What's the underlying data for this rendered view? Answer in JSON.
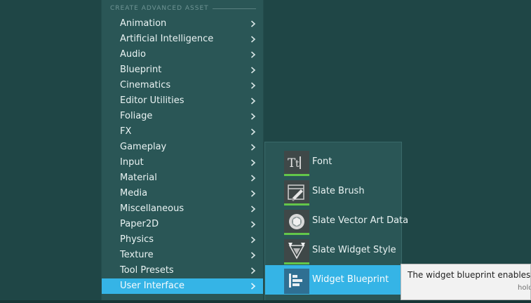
{
  "colors": {
    "background": "#1f4646",
    "menu_bg": "#2a5656",
    "selected_bg": "#35b4e6",
    "thumbnail_bar": "#63c64a",
    "tooltip_bg": "#f2f2f2"
  },
  "menu": {
    "section_header": "CREATE ADVANCED ASSET",
    "items": [
      {
        "label": "Animation",
        "icon": "chevron-right-icon"
      },
      {
        "label": "Artificial Intelligence",
        "icon": "chevron-right-icon"
      },
      {
        "label": "Audio",
        "icon": "chevron-right-icon"
      },
      {
        "label": "Blueprint",
        "icon": "chevron-right-icon"
      },
      {
        "label": "Cinematics",
        "icon": "chevron-right-icon"
      },
      {
        "label": "Editor Utilities",
        "icon": "chevron-right-icon"
      },
      {
        "label": "Foliage",
        "icon": "chevron-right-icon"
      },
      {
        "label": "FX",
        "icon": "chevron-right-icon"
      },
      {
        "label": "Gameplay",
        "icon": "chevron-right-icon"
      },
      {
        "label": "Input",
        "icon": "chevron-right-icon"
      },
      {
        "label": "Material",
        "icon": "chevron-right-icon"
      },
      {
        "label": "Media",
        "icon": "chevron-right-icon"
      },
      {
        "label": "Miscellaneous",
        "icon": "chevron-right-icon"
      },
      {
        "label": "Paper2D",
        "icon": "chevron-right-icon"
      },
      {
        "label": "Physics",
        "icon": "chevron-right-icon"
      },
      {
        "label": "Texture",
        "icon": "chevron-right-icon"
      },
      {
        "label": "Tool Presets",
        "icon": "chevron-right-icon"
      },
      {
        "label": "User Interface",
        "icon": "chevron-right-icon",
        "selected": true
      }
    ]
  },
  "submenu": {
    "items": [
      {
        "label": "Font",
        "icon": "font-asset-icon"
      },
      {
        "label": "Slate Brush",
        "icon": "slate-brush-icon"
      },
      {
        "label": "Slate Vector Art Data",
        "icon": "slate-vector-art-icon"
      },
      {
        "label": "Slate Widget Style",
        "icon": "slate-widget-style-icon"
      },
      {
        "label": "Widget Blueprint",
        "icon": "widget-blueprint-icon",
        "selected": true
      }
    ]
  },
  "tooltip": {
    "text": "The widget blueprint enables exte",
    "hint": "hold"
  }
}
